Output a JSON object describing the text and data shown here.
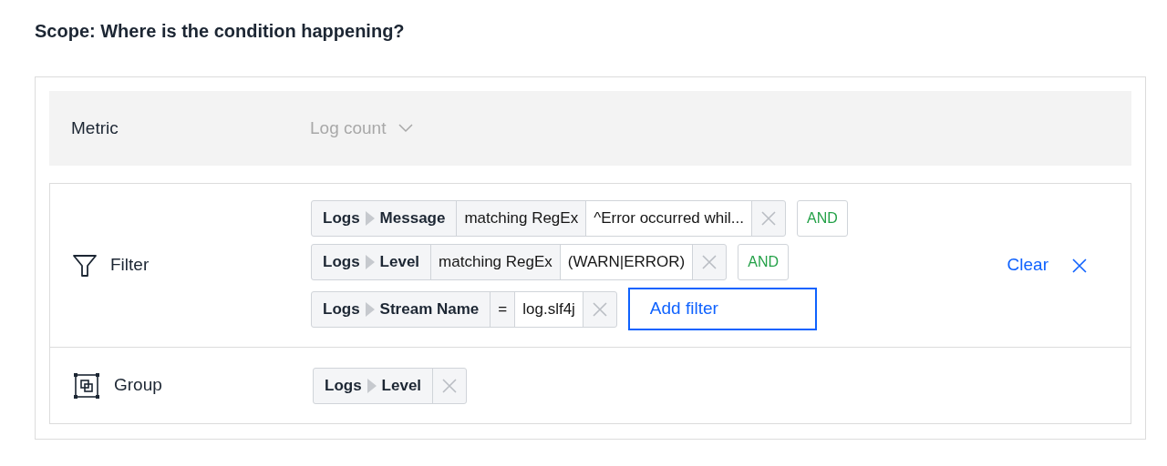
{
  "heading": "Scope: Where is the condition happening?",
  "metric": {
    "label": "Metric",
    "value": "Log count",
    "disabled": true
  },
  "filter": {
    "label": "Filter",
    "filters": [
      {
        "source": "Logs",
        "field": "Message",
        "operator": "matching RegEx",
        "value": "^Error occurred whil...",
        "connector": "AND"
      },
      {
        "source": "Logs",
        "field": "Level",
        "operator": "matching RegEx",
        "value": "(WARN|ERROR)",
        "connector": "AND"
      },
      {
        "source": "Logs",
        "field": "Stream Name",
        "operator": "=",
        "value": "log.slf4j"
      }
    ],
    "add_button": "Add filter",
    "clear_button": "Clear"
  },
  "group": {
    "label": "Group",
    "chips": [
      {
        "source": "Logs",
        "field": "Level"
      }
    ]
  }
}
